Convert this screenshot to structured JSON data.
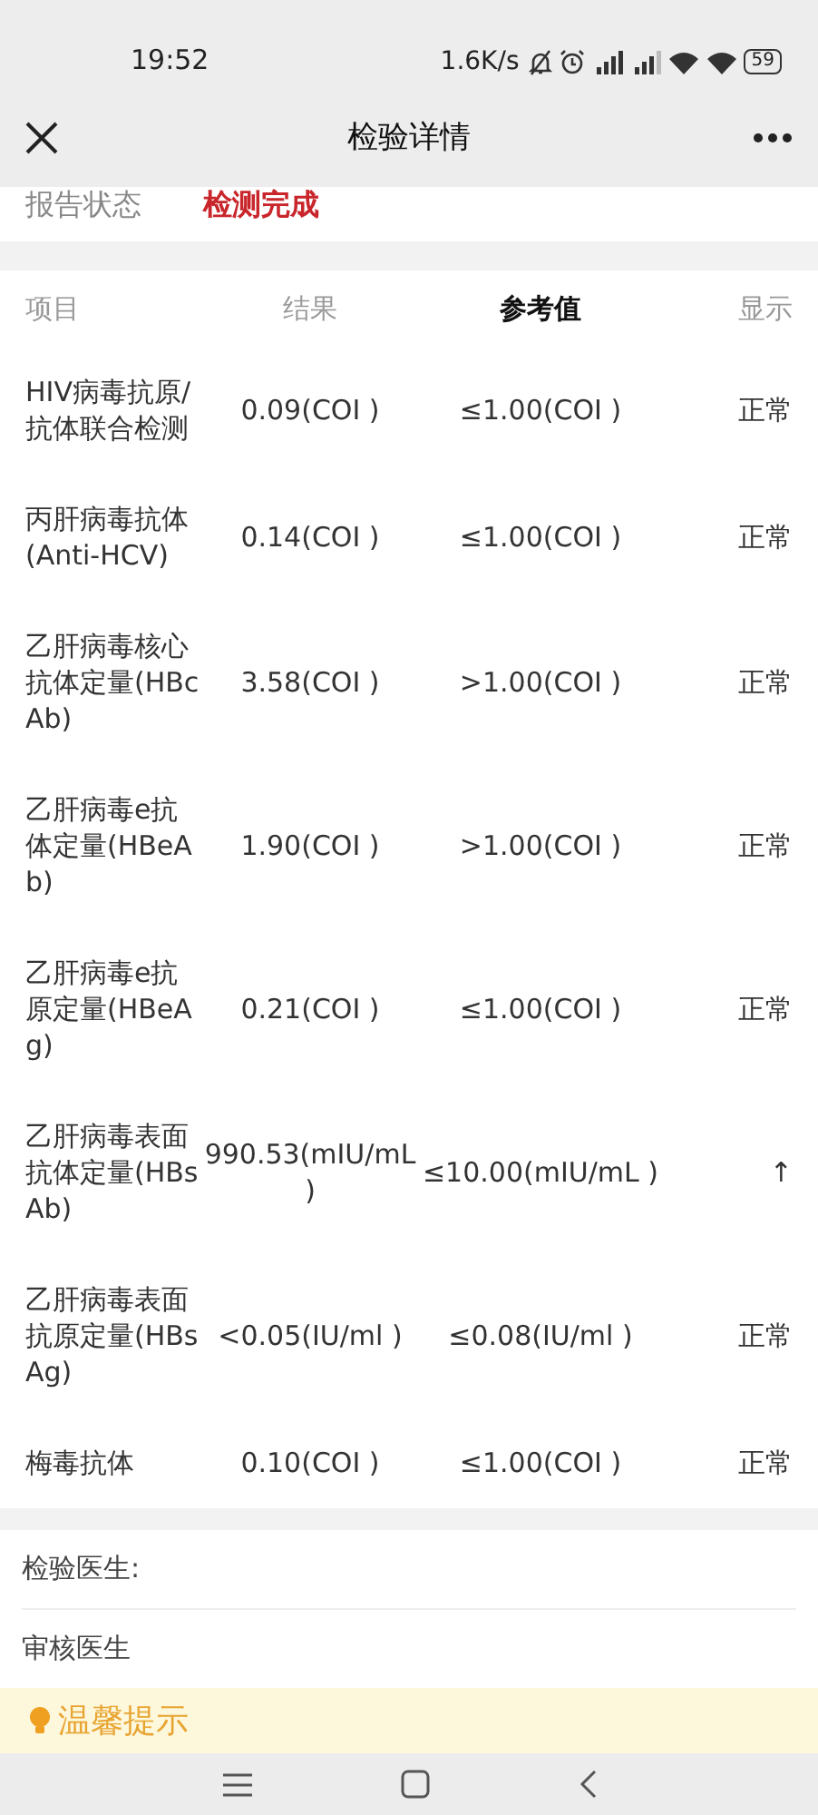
{
  "status_bar": {
    "time": "19:52",
    "speed": "1.6K/s",
    "battery": "59"
  },
  "header": {
    "title": "检验详情"
  },
  "report_status": {
    "label": "报告状态",
    "value": "检测完成"
  },
  "table": {
    "columns": [
      {
        "label": "项目",
        "selected": false
      },
      {
        "label": "结果",
        "selected": false
      },
      {
        "label": "参考值",
        "selected": true
      },
      {
        "label": "显示",
        "selected": false
      }
    ],
    "rows": [
      {
        "item": "HIV病毒抗原/抗体联合检测",
        "result": "0.09(COI )",
        "reference": "≤1.00(COI )",
        "display": "正常"
      },
      {
        "item": "丙肝病毒抗体(Anti-HCV)",
        "result": "0.14(COI )",
        "reference": "≤1.00(COI )",
        "display": "正常"
      },
      {
        "item": "乙肝病毒核心抗体定量(HBcAb)",
        "result": "3.58(COI )",
        "reference": ">1.00(COI )",
        "display": "正常"
      },
      {
        "item": "乙肝病毒e抗体定量(HBeAb)",
        "result": "1.90(COI )",
        "reference": ">1.00(COI )",
        "display": "正常"
      },
      {
        "item": "乙肝病毒e抗原定量(HBeAg)",
        "result": "0.21(COI )",
        "reference": "≤1.00(COI )",
        "display": "正常"
      },
      {
        "item": "乙肝病毒表面抗体定量(HBsAb)",
        "result": "990.53(mIU/mL )",
        "reference": "≤10.00(mIU/mL )",
        "display": "↑"
      },
      {
        "item": "乙肝病毒表面抗原定量(HBsAg)",
        "result": "<0.05(IU/ml )",
        "reference": "≤0.08(IU/ml )",
        "display": "正常"
      },
      {
        "item": "梅毒抗体",
        "result": "0.10(COI )",
        "reference": "≤1.00(COI )",
        "display": "正常"
      }
    ]
  },
  "doctors": [
    {
      "label": "检验医生:"
    },
    {
      "label": "审核医生"
    }
  ],
  "tip": {
    "title": "温馨提示"
  }
}
